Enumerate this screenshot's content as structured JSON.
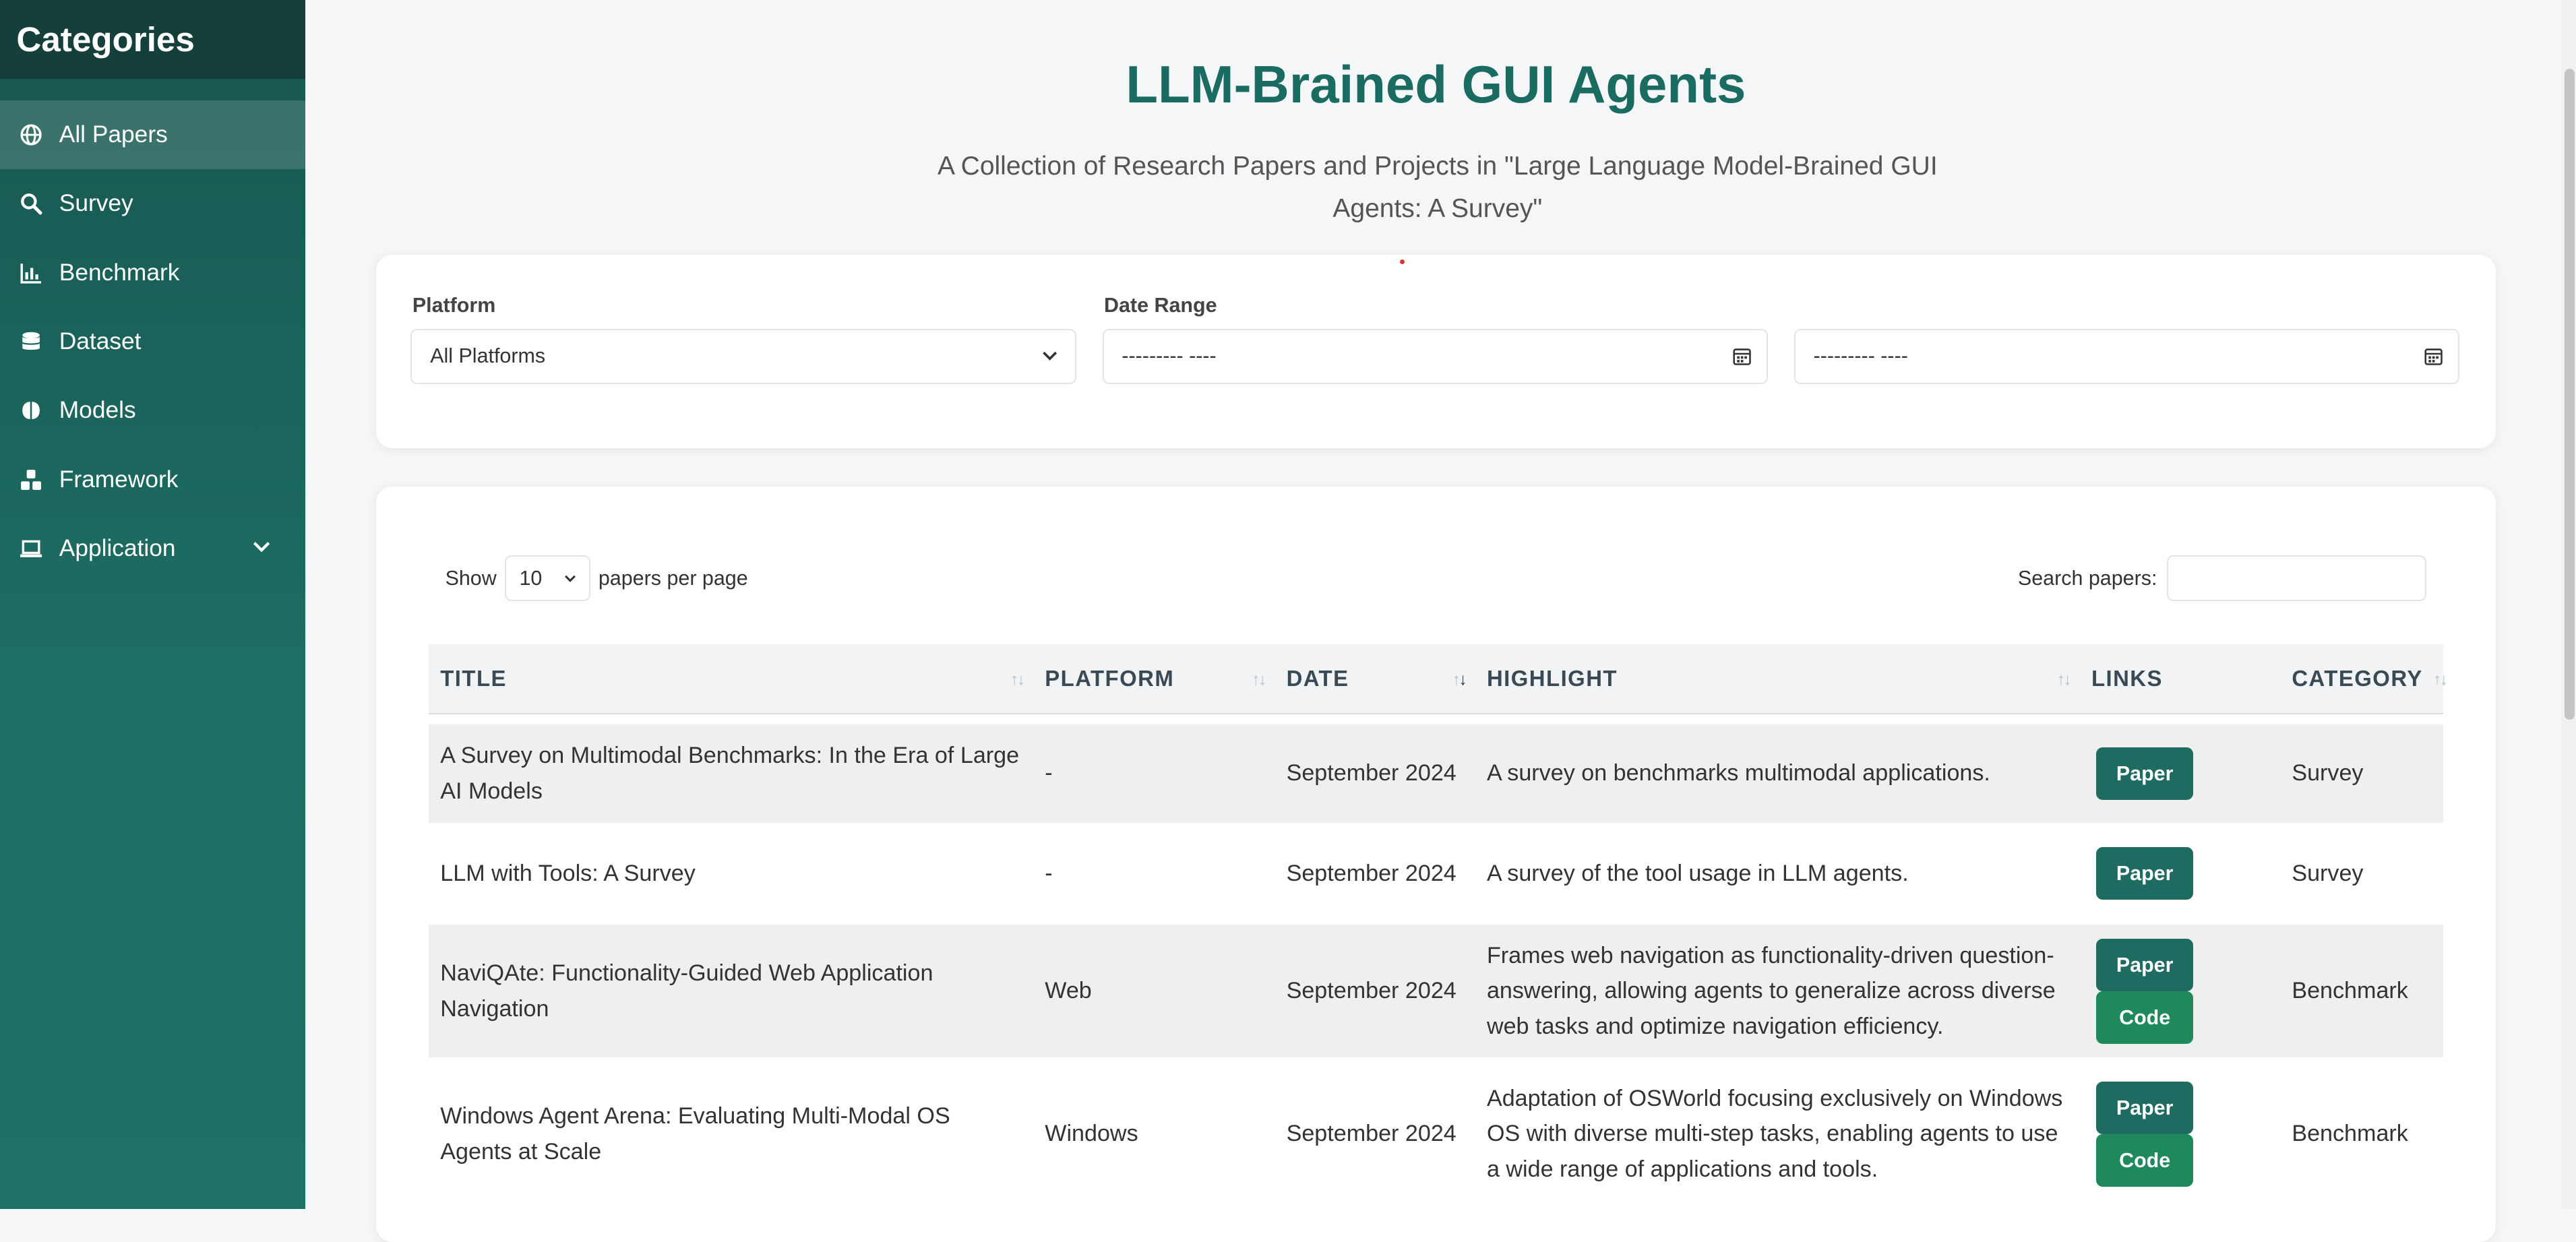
{
  "sidebar": {
    "title": "Categories",
    "items": [
      {
        "label": "All Papers",
        "icon": "globe-icon"
      },
      {
        "label": "Survey",
        "icon": "search-icon"
      },
      {
        "label": "Benchmark",
        "icon": "bar-chart-icon"
      },
      {
        "label": "Dataset",
        "icon": "database-icon"
      },
      {
        "label": "Models",
        "icon": "brain-icon"
      },
      {
        "label": "Framework",
        "icon": "cubes-icon"
      },
      {
        "label": "Application",
        "icon": "laptop-icon"
      }
    ]
  },
  "header": {
    "title": "LLM-Brained GUI Agents",
    "subtitle": "A Collection of Research Papers and Projects in \"Large Language Model-Brained GUI Agents: A Survey\""
  },
  "filters": {
    "platform_label": "Platform",
    "platform_value": "All Platforms",
    "date_label": "Date Range",
    "date_from": "--------- ----",
    "date_to": "--------- ----"
  },
  "controls": {
    "show_label": "Show",
    "page_size": "10",
    "per_page_label": "papers per page",
    "search_label": "Search papers:",
    "search_value": ""
  },
  "table": {
    "headers": [
      "TITLE",
      "PLATFORM",
      "DATE",
      "HIGHLIGHT",
      "LINKS",
      "CATEGORY"
    ],
    "rows": [
      {
        "title": "A Survey on Multimodal Benchmarks: In the Era of Large AI Models",
        "platform": "-",
        "date": "September 2024",
        "highlight": "A survey on benchmarks multimodal applications.",
        "links": [
          "Paper"
        ],
        "category": "Survey"
      },
      {
        "title": "LLM with Tools: A Survey",
        "platform": "-",
        "date": "September 2024",
        "highlight": "A survey of the tool usage in LLM agents.",
        "links": [
          "Paper"
        ],
        "category": "Survey"
      },
      {
        "title": "NaviQAte: Functionality-Guided Web Application Navigation",
        "platform": "Web",
        "date": "September 2024",
        "highlight": "Frames web navigation as functionality-driven question-answering, allowing agents to generalize across diverse web tasks and optimize navigation efficiency.",
        "links": [
          "Paper",
          "Code"
        ],
        "category": "Benchmark"
      },
      {
        "title": "Windows Agent Arena: Evaluating Multi-Modal OS Agents at Scale",
        "platform": "Windows",
        "date": "September 2024",
        "highlight": "Adaptation of OSWorld focusing exclusively on Windows OS with diverse multi-step tasks, enabling agents to use a wide range of applications and tools.",
        "links": [
          "Paper",
          "Code"
        ],
        "category": "Benchmark"
      }
    ]
  },
  "colors": {
    "accent": "#1a6b61",
    "sidebar_top": "#143f3b",
    "paper_button": "#1d6b61",
    "code_button": "#1e8a5c"
  }
}
